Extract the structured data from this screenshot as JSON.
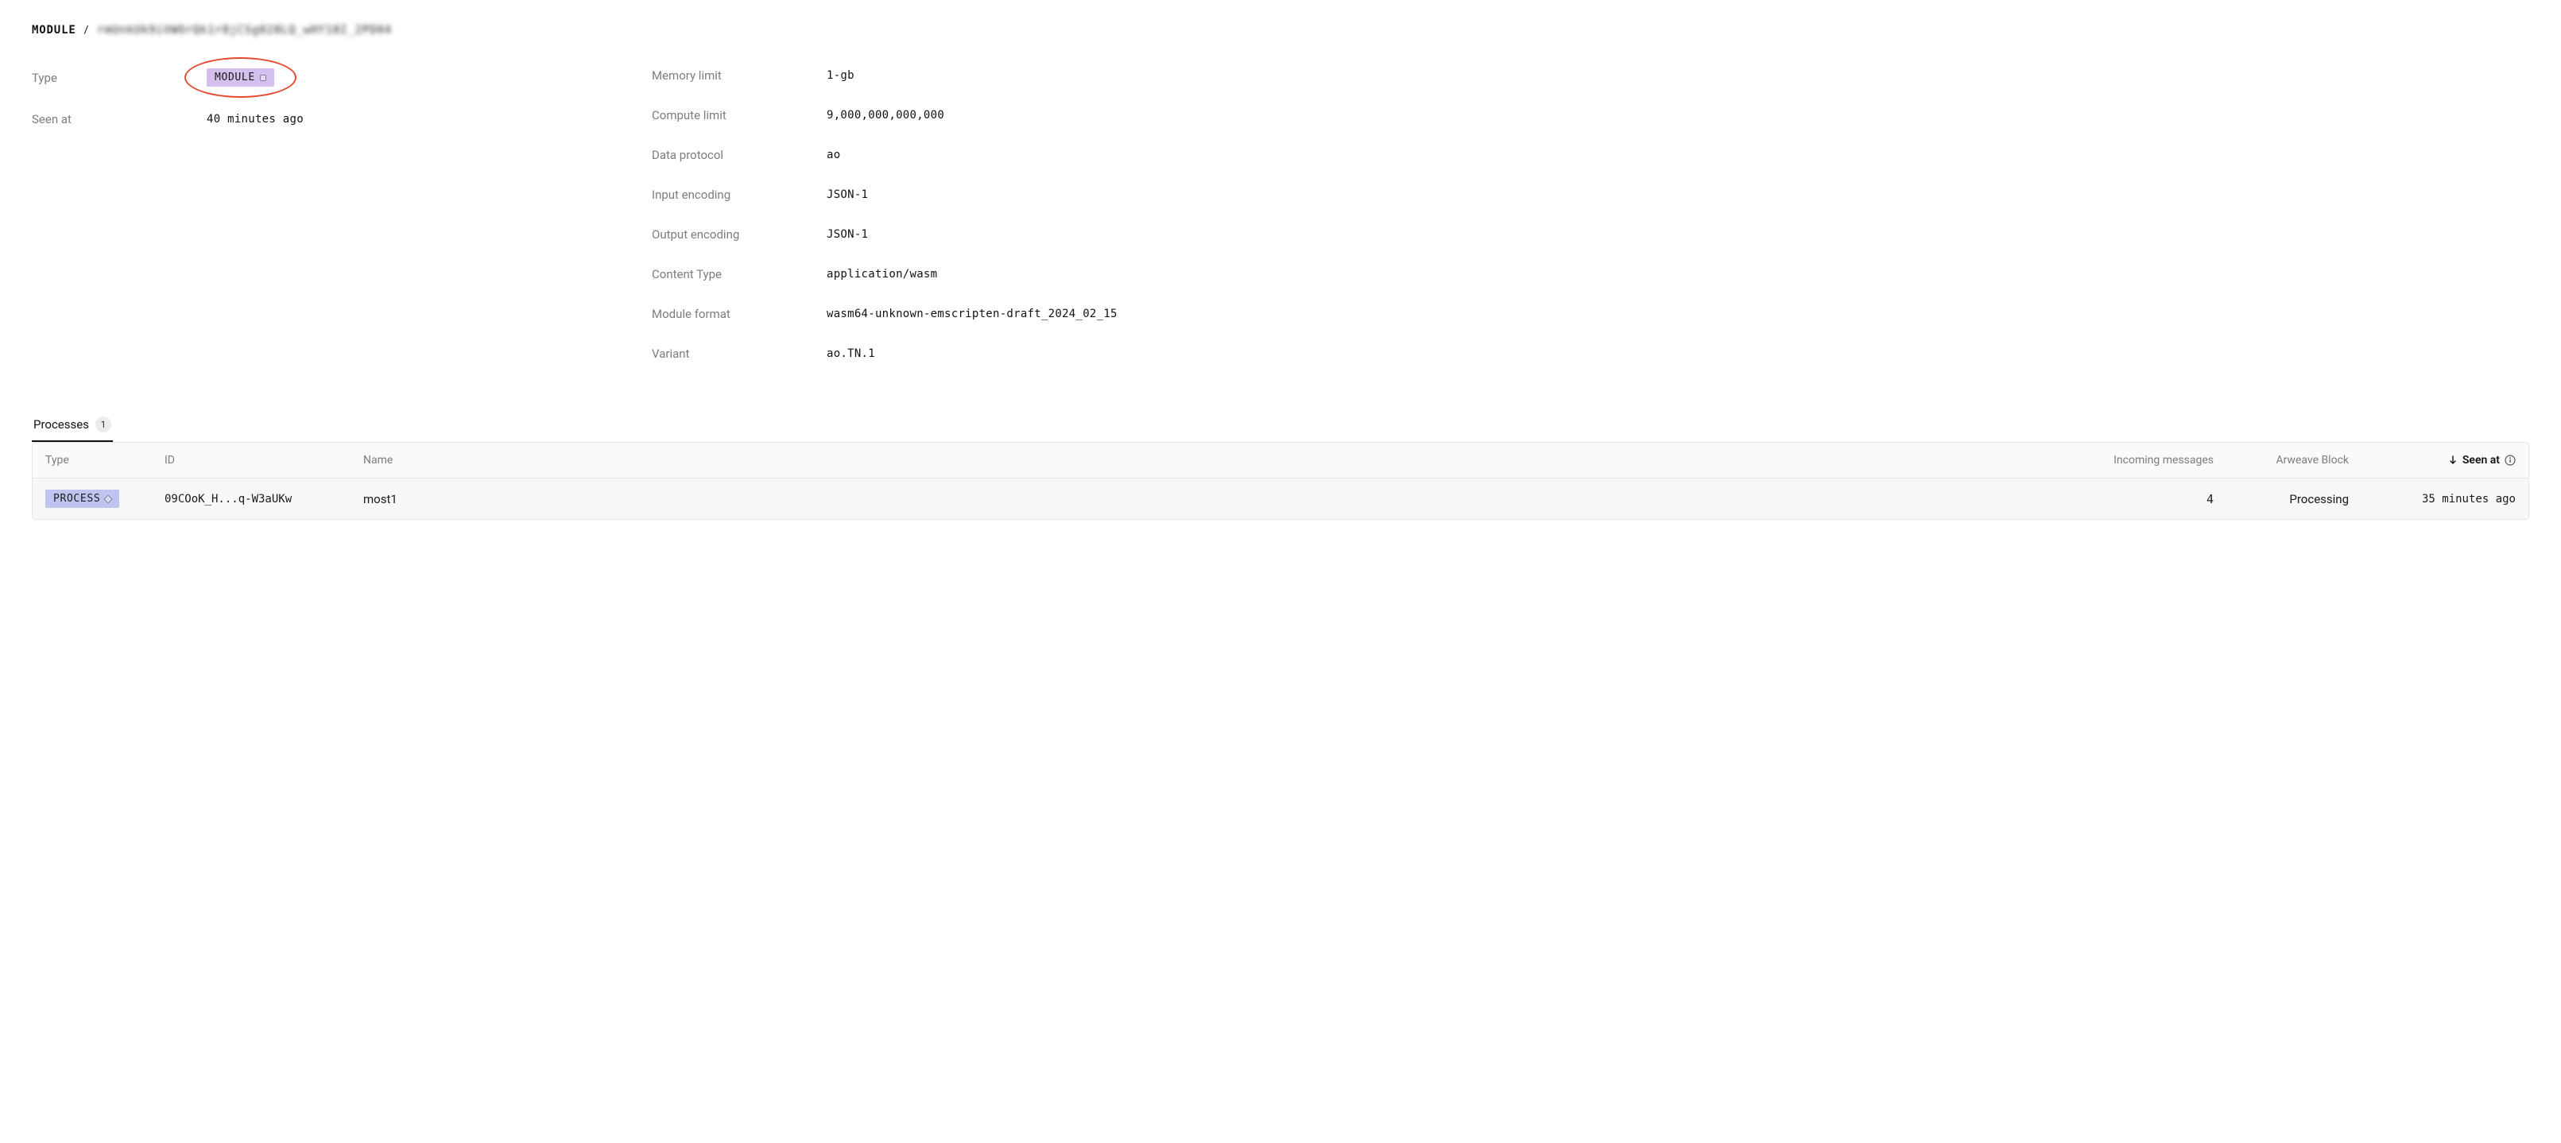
{
  "breadcrumb": {
    "root": "MODULE",
    "separator": "/",
    "id": "rmUnkUk9iVWOrQk1r8jCSg028LQ_wHY18I_2PD04"
  },
  "left": {
    "type": {
      "label": "Type",
      "value": "MODULE"
    },
    "seen_at": {
      "label": "Seen at",
      "value": "40 minutes ago"
    }
  },
  "right": {
    "memory_limit": {
      "label": "Memory limit",
      "value": "1-gb"
    },
    "compute_limit": {
      "label": "Compute limit",
      "value": "9,000,000,000,000"
    },
    "data_protocol": {
      "label": "Data protocol",
      "value": "ao"
    },
    "input_encoding": {
      "label": "Input encoding",
      "value": "JSON-1"
    },
    "output_encoding": {
      "label": "Output encoding",
      "value": "JSON-1"
    },
    "content_type": {
      "label": "Content Type",
      "value": "application/wasm"
    },
    "module_format": {
      "label": "Module format",
      "value": "wasm64-unknown-emscripten-draft_2024_02_15"
    },
    "variant": {
      "label": "Variant",
      "value": "ao.TN.1"
    }
  },
  "tabs": {
    "processes": {
      "label": "Processes",
      "count": "1"
    }
  },
  "table": {
    "headers": {
      "type": "Type",
      "id": "ID",
      "name": "Name",
      "incoming": "Incoming messages",
      "block": "Arweave Block",
      "seen": "Seen at"
    },
    "rows": [
      {
        "type": "PROCESS",
        "id": "09COoK_H...q-W3aUKw",
        "name": "most1",
        "incoming": "4",
        "block": "Processing",
        "seen": "35 minutes ago"
      }
    ]
  }
}
